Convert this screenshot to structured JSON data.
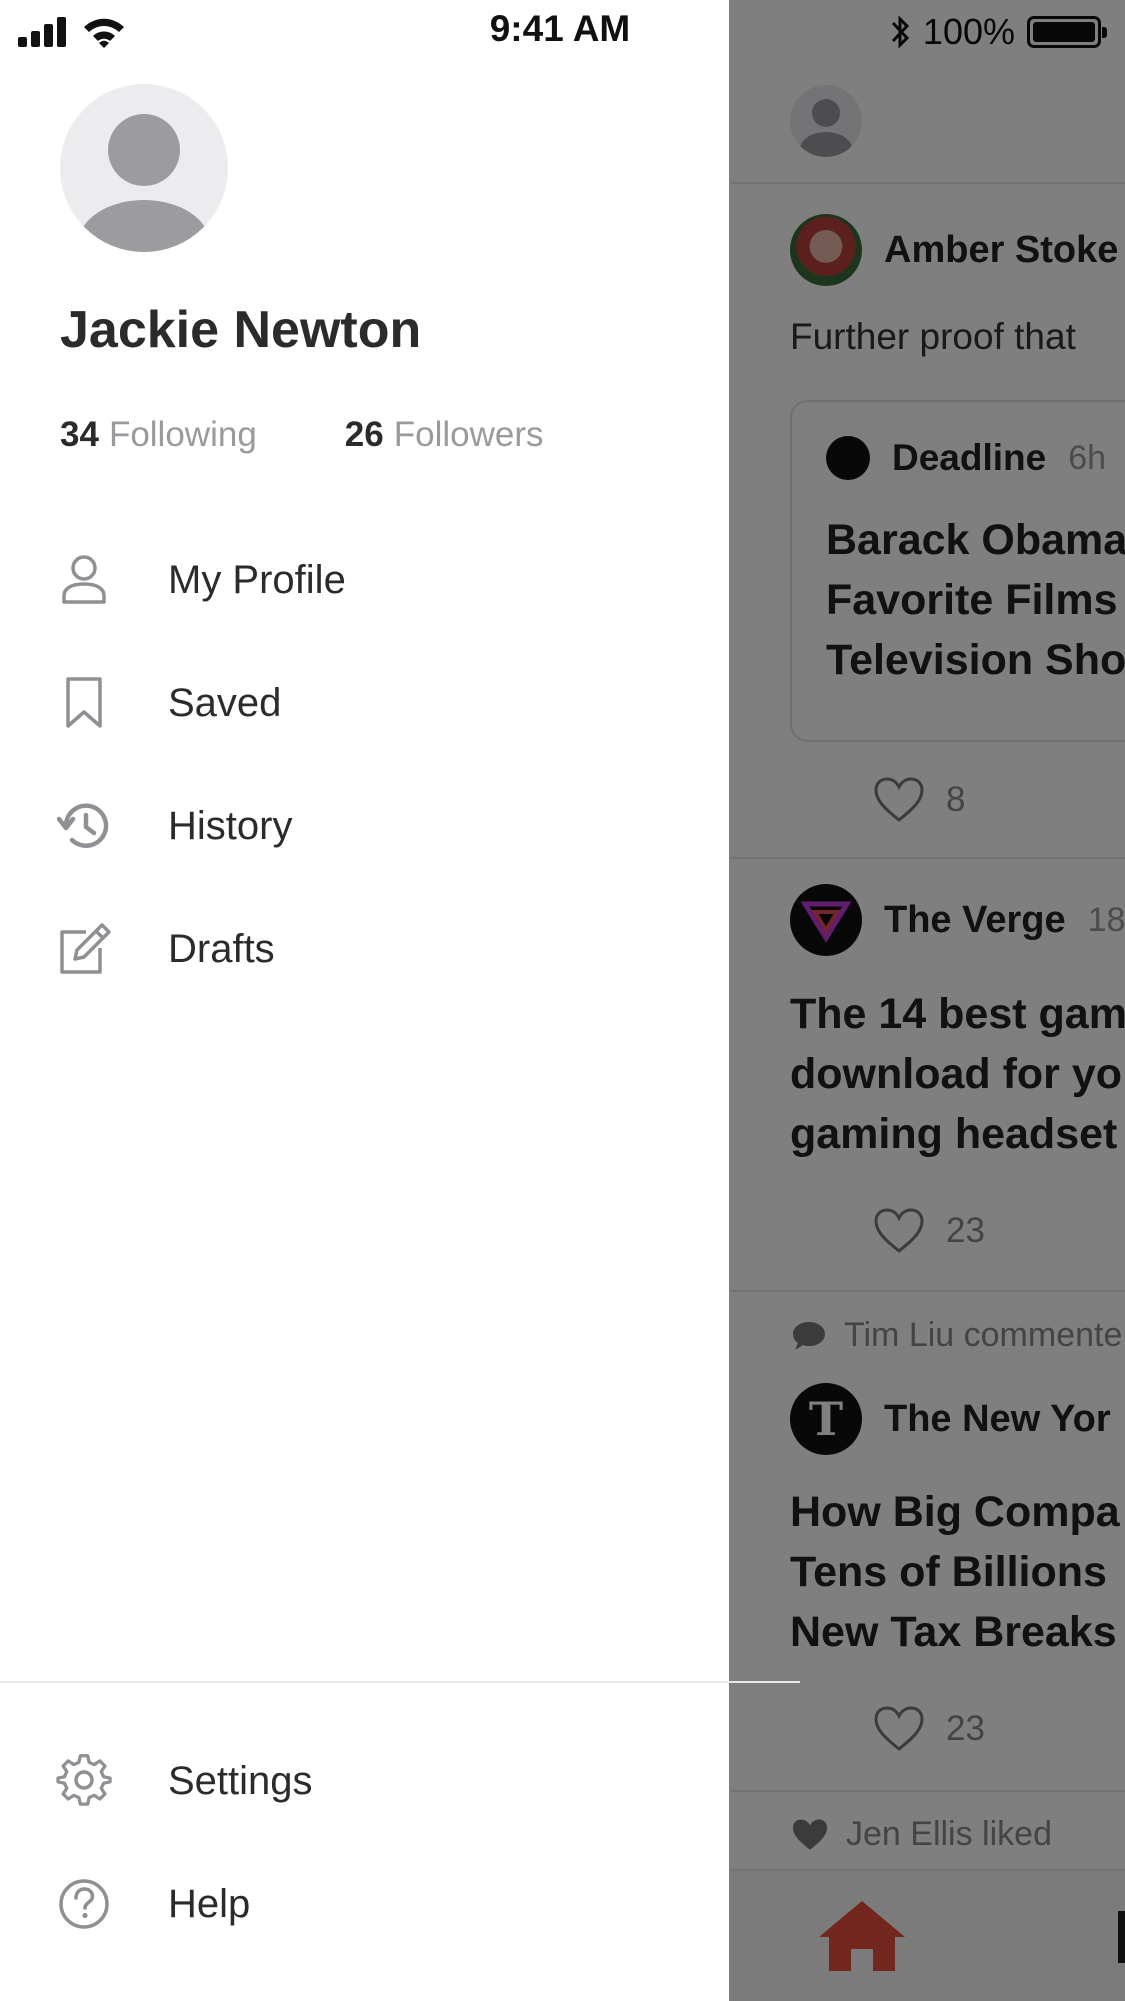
{
  "status_bar": {
    "time": "9:41 AM",
    "battery": "100%"
  },
  "drawer": {
    "profile": {
      "name": "Jackie Newton",
      "following_count": "34",
      "following_label": "Following",
      "followers_count": "26",
      "followers_label": "Followers"
    },
    "menu": [
      {
        "label": "My Profile",
        "icon": "person-icon"
      },
      {
        "label": "Saved",
        "icon": "bookmark-icon"
      },
      {
        "label": "History",
        "icon": "history-icon"
      },
      {
        "label": "Drafts",
        "icon": "edit-icon"
      }
    ],
    "footer_menu": [
      {
        "label": "Settings",
        "icon": "gear-icon"
      },
      {
        "label": "Help",
        "icon": "help-icon"
      }
    ]
  },
  "feed": {
    "posts": [
      {
        "author": "Amber Stoke",
        "text": "Further proof that",
        "embed_source": "Deadline",
        "embed_time": "6h",
        "embed_headline": [
          "Barack Obama",
          "Favorite Films",
          "Television Sho"
        ],
        "likes": "8"
      },
      {
        "author": "The Verge",
        "time": "18",
        "headline": [
          "The 14 best gam",
          "download for yo",
          "gaming headset"
        ],
        "likes": "23"
      },
      {
        "activity": "Tim Liu commente",
        "author": "The New Yor",
        "headline": [
          "How Big Compa",
          "Tens of Billions",
          "New Tax Breaks"
        ],
        "likes": "23"
      }
    ],
    "activity_bottom": "Jen Ellis liked"
  },
  "colors": {
    "scrim": "rgba(0,0,0,0.5)",
    "home_tab_accent": "#c0392b",
    "icon_gray": "#8f8f94"
  }
}
